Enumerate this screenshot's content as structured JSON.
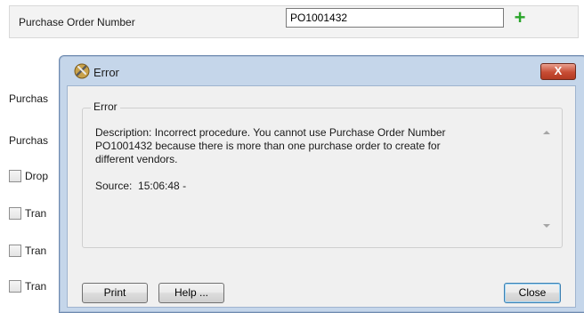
{
  "form": {
    "po_number_label": "Purchase Order Number",
    "po_number_value": "PO1001432",
    "rows": [
      {
        "label": "Purchas"
      },
      {
        "label": "Purchas"
      }
    ],
    "checkboxes": [
      {
        "label": "Drop",
        "checked": false
      },
      {
        "label": "Tran",
        "checked": false
      },
      {
        "label": "Tran",
        "checked": false
      },
      {
        "label": "Tran",
        "checked": false
      }
    ],
    "add_icon": "plus-icon"
  },
  "dialog": {
    "title": "Error",
    "title_icon": "error-tools-icon",
    "close_glyph": "X",
    "group_label": "Error",
    "message": "Description: Incorrect procedure. You cannot use Purchase Order Number\nPO1001432 because there is more than one purchase order to create for\ndifferent vendors.\n\nSource:  15:06:48 -",
    "buttons": {
      "print": "Print",
      "help": "Help ...",
      "close": "Close"
    }
  },
  "colors": {
    "dialog_frame": "#c5d6ea",
    "close_button": "#c74c34",
    "add_icon": "#2aa52a"
  }
}
